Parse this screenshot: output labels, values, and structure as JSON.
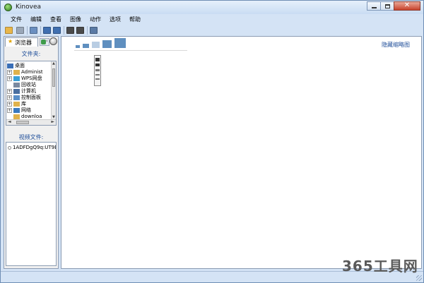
{
  "window": {
    "title": "Kinovea",
    "close_glyph": "✕"
  },
  "menu": [
    "文件",
    "编辑",
    "查看",
    "图像",
    "动作",
    "选项",
    "帮助"
  ],
  "toolbar": {
    "buttons": [
      {
        "name": "open-folder-icon",
        "color": "#e8b64a"
      },
      {
        "name": "save-icon",
        "color": "#9aa7b8"
      },
      {
        "name": "single-view-icon",
        "color": "#6b8fc0"
      },
      {
        "name": "dual-view-icon",
        "color": "#3f6fb0"
      },
      {
        "name": "dual-horizontal-icon",
        "color": "#3f6fb0"
      },
      {
        "name": "capture-icon",
        "color": "#4a4a4a"
      },
      {
        "name": "capture-dual-icon",
        "color": "#4a4a4a"
      },
      {
        "name": "settings-icon",
        "color": "#5a7aa5"
      }
    ]
  },
  "left_panel": {
    "tab_active_label": "浏览器",
    "tab_star": "★",
    "tab2_arrow": "‹",
    "folders_label": "文件夹:",
    "tree": [
      {
        "label": "桌面",
        "expand": "",
        "indent": 0,
        "color": "#3a6fb7",
        "name": "tree-item-desktop"
      },
      {
        "label": "Administ",
        "expand": "+",
        "indent": 1,
        "color": "#e0b24c",
        "name": "tree-item-administrator"
      },
      {
        "label": "WPS网盘",
        "expand": "+",
        "indent": 1,
        "color": "#3aa0d8",
        "name": "tree-item-wps"
      },
      {
        "label": "回收站",
        "expand": "",
        "indent": 1,
        "color": "#7a8aa0",
        "name": "tree-item-recycle-bin"
      },
      {
        "label": "计算机",
        "expand": "+",
        "indent": 1,
        "color": "#4a6fa0",
        "name": "tree-item-computer"
      },
      {
        "label": "控制面板",
        "expand": "+",
        "indent": 1,
        "color": "#5a8fc8",
        "name": "tree-item-control-panel"
      },
      {
        "label": "库",
        "expand": "+",
        "indent": 1,
        "color": "#e0b24c",
        "name": "tree-item-library"
      },
      {
        "label": "网络",
        "expand": "+",
        "indent": 1,
        "color": "#3a7ac0",
        "name": "tree-item-network"
      },
      {
        "label": "downloa",
        "expand": "",
        "indent": 1,
        "color": "#e0b24c",
        "name": "tree-item-downloads"
      }
    ],
    "scroll_up": "▲",
    "scroll_down": "▼",
    "scroll_left": "◄",
    "scroll_right": "►",
    "video_files_label": "视频文件:",
    "files": [
      "1ADFDgQ9q:UT9Bn"
    ]
  },
  "main": {
    "hide_thumbnails": "隐藏缩略图",
    "thumb_size_options": [
      1,
      2,
      3,
      4,
      5
    ]
  },
  "watermark": "365工具网"
}
